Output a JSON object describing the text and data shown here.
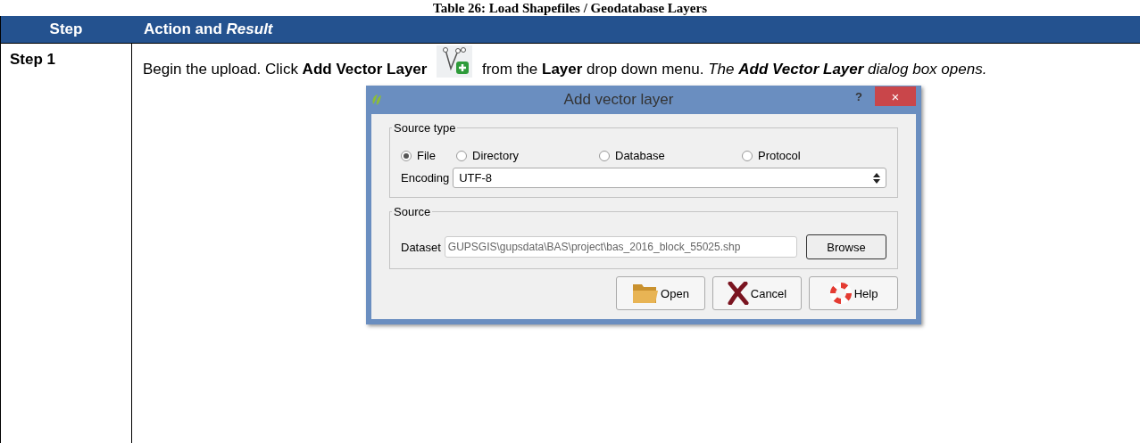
{
  "caption": "Table 26: Load Shapefiles / Geodatabase Layers",
  "table": {
    "columns": [
      "Step",
      "Action and *Result*"
    ],
    "rows": [
      {
        "step": "Step 1",
        "before_icon": "Begin the upload. Click **Add Vector Layer**",
        "after_icon": "from the **Layer** drop down menu.",
        "result": "The **Add Vector Layer** dialog box opens.",
        "dialog": {
          "title": "Add vector layer",
          "help": "?",
          "close": "×",
          "source_type": {
            "legend": "Source type",
            "options": [
              {
                "label": "File",
                "selected": true
              },
              {
                "label": "Directory",
                "selected": false
              },
              {
                "label": "Database",
                "selected": false
              },
              {
                "label": "Protocol",
                "selected": false
              }
            ],
            "encoding_label": "Encoding",
            "encoding_value": "UTF-8"
          },
          "source": {
            "legend": "Source",
            "dataset_label": "Dataset",
            "dataset_value": "GUPSGIS\\gupsdata\\BAS\\project\\bas_2016_block_55025.shp",
            "browse": "Browse"
          },
          "buttons": [
            {
              "kind": "open",
              "label": "Open"
            },
            {
              "kind": "cancel",
              "label": "Cancel"
            },
            {
              "kind": "help",
              "label": "Help"
            }
          ]
        }
      }
    ]
  }
}
